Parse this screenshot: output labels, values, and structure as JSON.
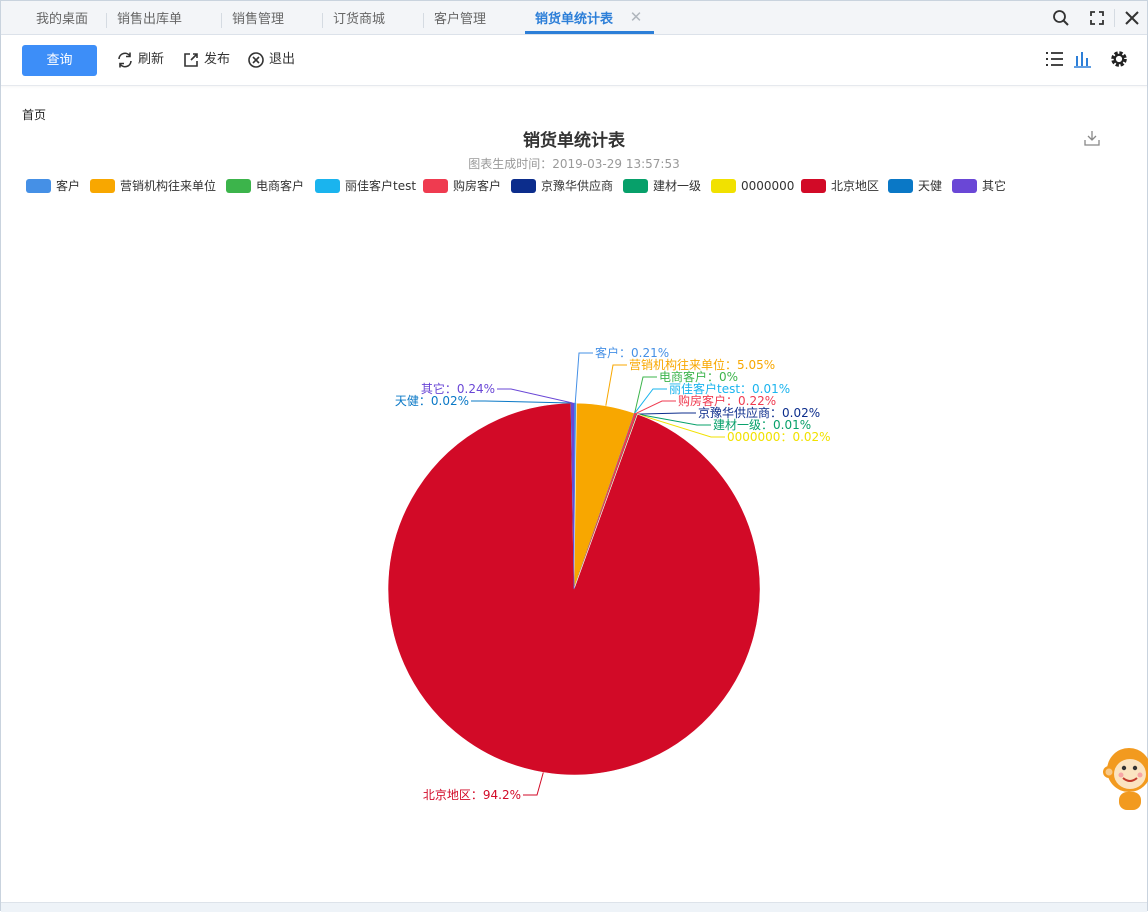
{
  "tabs": [
    {
      "label": "我的桌面"
    },
    {
      "label": "销售出库单"
    },
    {
      "label": "销售管理"
    },
    {
      "label": "订货商城"
    },
    {
      "label": "客户管理"
    },
    {
      "label": "销货单统计表"
    }
  ],
  "toolbar": {
    "query_label": "查询",
    "refresh_label": "刷新",
    "publish_label": "发布",
    "exit_label": "退出"
  },
  "breadcrumb": "首页",
  "colors": {
    "accent": "#3d8ef8",
    "tab_active": "#2d7fd8"
  },
  "chart_data": {
    "type": "pie",
    "title": "销货单统计表",
    "subtitle": "图表生成时间：2019-03-29 13:57:53",
    "legend_position": "top",
    "slices": [
      {
        "name": "客户",
        "value": 0.21,
        "label": "客户：0.21%",
        "color": "#4590e6"
      },
      {
        "name": "营销机构往来单位",
        "value": 5.05,
        "label": "营销机构往来单位：5.05%",
        "color": "#f8a700"
      },
      {
        "name": "电商客户",
        "value": 0,
        "label": "电商客户：0%",
        "color": "#3cb44b"
      },
      {
        "name": "丽佳客户test",
        "value": 0.01,
        "label": "丽佳客户test：0.01%",
        "color": "#1ab4ee"
      },
      {
        "name": "购房客户",
        "value": 0.22,
        "label": "购房客户：0.22%",
        "color": "#ef3b50"
      },
      {
        "name": "京豫华供应商",
        "value": 0.02,
        "label": "京豫华供应商：0.02%",
        "color": "#0c2d8c"
      },
      {
        "name": "建材一级",
        "value": 0.01,
        "label": "建材一级：0.01%",
        "color": "#07a06a"
      },
      {
        "name": "0000000",
        "value": 0.02,
        "label": "0000000：0.02%",
        "color": "#f1e100"
      },
      {
        "name": "北京地区",
        "value": 94.2,
        "label": "北京地区：94.2%",
        "color": "#d20a27"
      },
      {
        "name": "天健",
        "value": 0.02,
        "label": "天健：0.02%",
        "color": "#0a78c6"
      },
      {
        "name": "其它",
        "value": 0.24,
        "label": "其它：0.24%",
        "color": "#6a47d6"
      }
    ]
  }
}
